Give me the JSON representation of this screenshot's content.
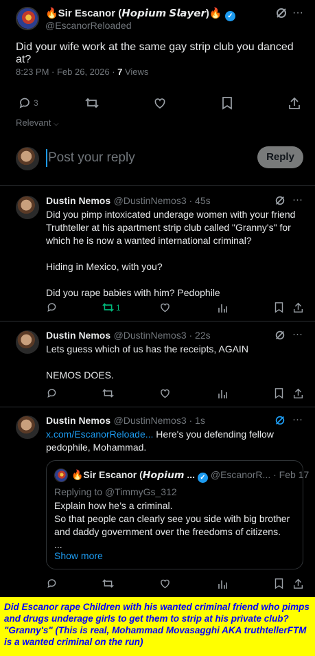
{
  "main_post": {
    "name": "🔥Sir Escanor (𝙃𝙤𝙥𝙞𝙪𝙢 𝙎𝙡𝙖𝙮𝙚𝙧)🔥",
    "handle": "@EscanorReloaded",
    "text": "Did your wife work at the same gay strip club you danced at?",
    "time": "8:23 PM · Feb 26, 2026 · ",
    "views_count": "7",
    "views_label": " Views",
    "reply_count": "3",
    "sort_label": "Relevant"
  },
  "composer": {
    "placeholder": "Post your reply",
    "button_label": "Reply"
  },
  "replies": [
    {
      "name": "Dustin Nemos",
      "handle": "@DustinNemos3 · 45s",
      "text": "Did you pimp intoxicated underage women with your friend Truthteller at his apartment strip club called \"Granny's\" for which he is now a wanted international criminal?\n\nHiding in Mexico, with you?\n\nDid you rape babies with him? Pedophile",
      "repost_count": "1"
    },
    {
      "name": "Dustin Nemos",
      "handle": "@DustinNemos3 · 22s",
      "text": "Lets guess which of us has the receipts, AGAIN\n\nNEMOS DOES."
    },
    {
      "name": "Dustin Nemos",
      "handle": "@DustinNemos3 · 1s",
      "link": "x.com/EscanorReloade...",
      "text": " Here's you defending fellow pedophile, Mohammad.",
      "quote": {
        "name": "🔥Sir Escanor (𝙃𝙤𝙥𝙞𝙪𝙢 ...",
        "handle": "@EscanorR...",
        "date": "· Feb 17",
        "replying_to": "Replying to @TimmyGs_312",
        "text": "Explain how he’s a criminal.\nSo that people can clearly see you side with big brother and daddy government over the freedoms of citizens.\n...",
        "show_more": "Show more"
      }
    }
  ],
  "banner": {
    "text": "Did Escanor rape Children with his wanted criminal friend who pimps and drugs underage girls to get them to strip at his private club? \"Granny's\" (This is real, Mohammad Movasagghi AKA truthtellerFTM is a wanted criminal on the run)"
  },
  "colors": {
    "background": "#000000",
    "text": "#e7e9ea",
    "muted": "#71767b",
    "accent": "#1d9bf0",
    "repost_active": "#00ba7c",
    "banner_bg": "#ffff00",
    "banner_text": "#0000ff"
  }
}
